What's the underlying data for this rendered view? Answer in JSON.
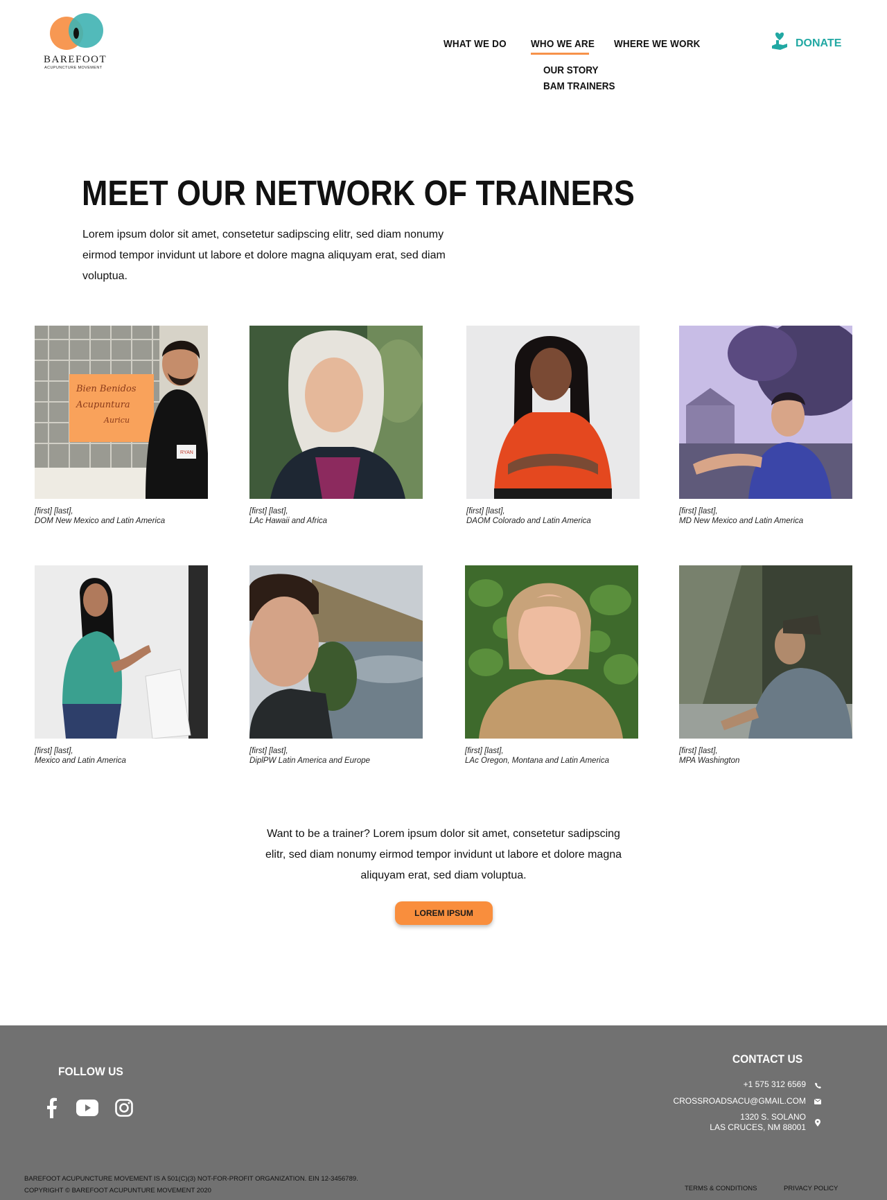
{
  "brand": {
    "name": "BAREFOOT",
    "tagline": "ACUPUNCTURE MOVEMENT"
  },
  "nav": {
    "items": [
      "WHAT WE DO",
      "WHO WE ARE",
      "WHERE WE WORK"
    ],
    "active": "WHO WE ARE",
    "submenu": [
      "OUR STORY",
      "BAM TRAINERS"
    ],
    "donate": "DONATE"
  },
  "hero": {
    "title": "MEET OUR NETWORK OF TRAINERS",
    "text": "Lorem ipsum dolor sit amet, consetetur sadipscing elitr, sed diam nonumy eirmod tempor invidunt ut labore et dolore magna aliquyam erat, sed diam voluptua."
  },
  "trainers": [
    {
      "name": "[first] [last],",
      "credentials": "DOM New Mexico and Latin America"
    },
    {
      "name": "[first] [last],",
      "credentials": "LAc Hawaii and Africa"
    },
    {
      "name": "[first] [last],",
      "credentials": "DAOM Colorado and Latin America"
    },
    {
      "name": "[first] [last],",
      "credentials": "MD New Mexico and Latin America"
    },
    {
      "name": " [first] [last],",
      "credentials": "Mexico and Latin America"
    },
    {
      "name": "[first] [last],",
      "credentials": "DiplPW Latin America and Europe"
    },
    {
      "name": "[first] [last],",
      "credentials": "LAc Oregon, Montana and Latin America"
    },
    {
      "name": "[first] [last],",
      "credentials": "MPA Washington"
    }
  ],
  "sign_text": {
    "line1": "Bien Benidos",
    "line2": "Acupuntura",
    "line3": "Auricu",
    "badge": "RYAN"
  },
  "cta": {
    "text": "Want to be a trainer? Lorem ipsum dolor sit amet, consetetur sadipscing elitr, sed diam nonumy eirmod tempor invidunt ut labore et dolore magna aliquyam erat, sed diam voluptua.",
    "button": "LOREM IPSUM"
  },
  "footer": {
    "follow_title": "FOLLOW US",
    "social_icons": [
      "facebook-icon",
      "youtube-icon",
      "instagram-icon"
    ],
    "contact_title": "CONTACT US",
    "phone": "+1 575 312 6569",
    "email": "CROSSROADSACU@GMAIL.COM",
    "address_line1": "1320 S. SOLANO",
    "address_line2": "LAS CRUCES, NM 88001",
    "legal_line1": "BAREFOOT ACUPUNCTURE MOVEMENT IS A 501(C)(3) NOT-FOR-PROFIT ORGANIZATION. EIN 12-3456789.",
    "legal_line2": "COPYRIGHT © BAREFOOT ACUPUNTURE MOVEMENT 2020",
    "links": [
      "TERMS & CONDITIONS",
      "PRIVACY POLICY"
    ]
  },
  "colors": {
    "accent_orange": "#f98e3d",
    "accent_teal": "#21a8a3",
    "footer_bg": "#717171"
  }
}
